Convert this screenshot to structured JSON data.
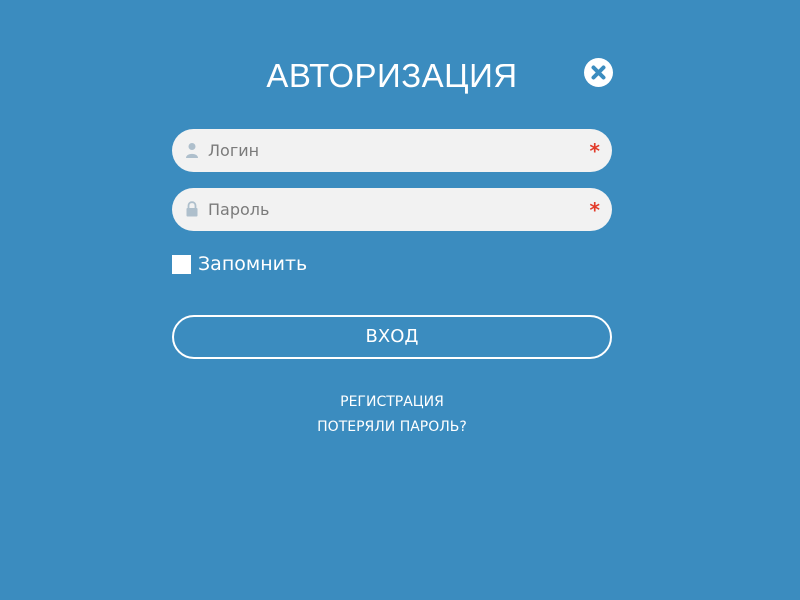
{
  "dialog": {
    "title": "АВТОРИЗАЦИЯ",
    "close_icon": "close-icon"
  },
  "form": {
    "login": {
      "placeholder": "Логин",
      "value": "",
      "icon": "user-icon",
      "required_mark": "*"
    },
    "password": {
      "placeholder": "Пароль",
      "value": "",
      "icon": "lock-icon",
      "required_mark": "*"
    },
    "remember": {
      "label": "Запомнить",
      "checked": false
    },
    "submit_label": "ВХОД"
  },
  "links": {
    "register": "РЕГИСТРАЦИЯ",
    "lost_password": "ПОТЕРЯЛИ ПАРОЛЬ?"
  },
  "colors": {
    "background": "#3b8cbf",
    "field_background": "#f2f2f2",
    "required": "#e23b2a",
    "icon": "#aebfcc",
    "text": "#ffffff"
  }
}
